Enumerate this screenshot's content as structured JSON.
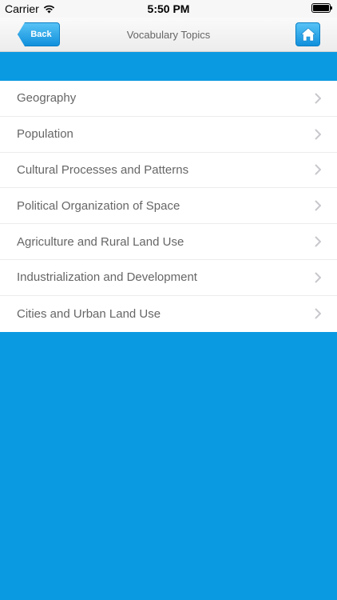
{
  "status_bar": {
    "carrier": "Carrier",
    "time": "5:50 PM"
  },
  "nav": {
    "back_label": "Back",
    "title": "Vocabulary Topics"
  },
  "topics": [
    {
      "label": "Geography"
    },
    {
      "label": "Population"
    },
    {
      "label": "Cultural Processes and Patterns"
    },
    {
      "label": "Political Organization of Space"
    },
    {
      "label": "Agriculture and Rural Land Use"
    },
    {
      "label": "Industrialization and Development"
    },
    {
      "label": "Cities and Urban Land Use"
    }
  ],
  "colors": {
    "accent_blue": "#0a9ae2",
    "button_blue": "#1190dc"
  },
  "icons": {
    "wifi": "wifi-icon",
    "battery": "battery-icon",
    "home": "home-icon",
    "chevron": "chevron-right-icon"
  }
}
